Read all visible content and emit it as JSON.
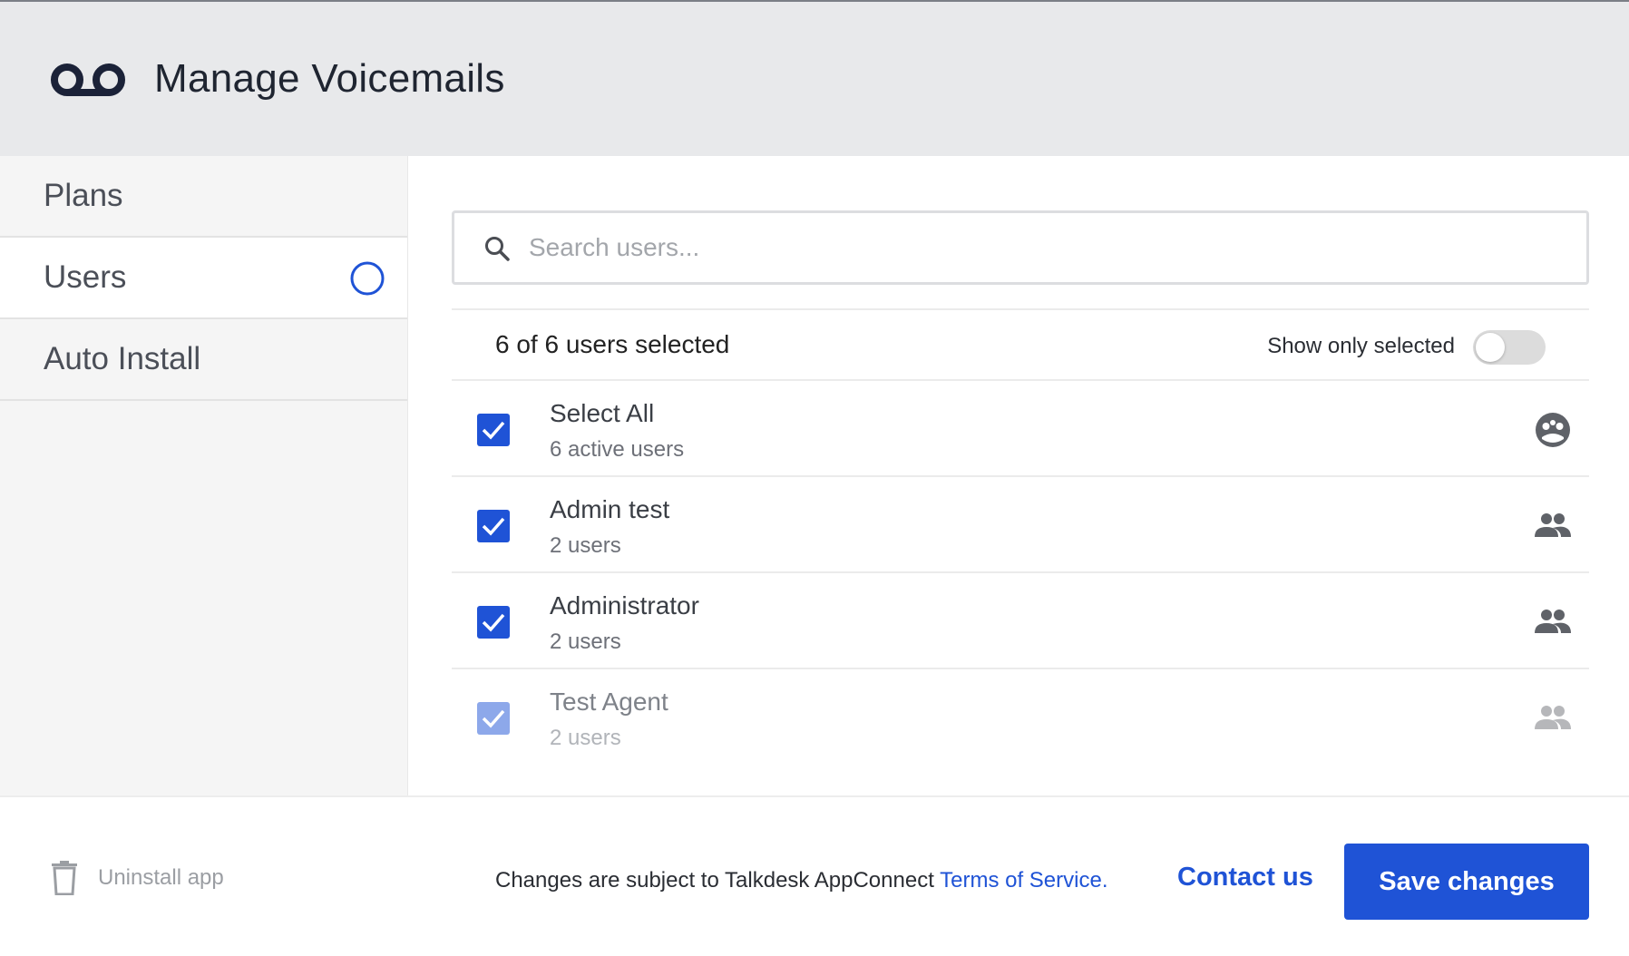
{
  "header": {
    "title": "Manage Voicemails",
    "logo_icon": "voicemail-icon"
  },
  "sidebar": {
    "items": [
      {
        "label": "Plans",
        "active": false
      },
      {
        "label": "Users",
        "active": true,
        "status_icon": "progress-ring-icon"
      },
      {
        "label": "Auto Install",
        "active": false
      }
    ]
  },
  "search": {
    "placeholder": "Search users...",
    "value": ""
  },
  "summary": {
    "count_text": "6 of 6 users selected",
    "toggle_label": "Show only selected",
    "toggle_on": false
  },
  "rows": [
    {
      "name": "Select All",
      "sub": "6 active users",
      "checked": true,
      "icon": "all-users-icon"
    },
    {
      "name": "Admin test",
      "sub": "2 users",
      "checked": true,
      "icon": "group-icon"
    },
    {
      "name": "Administrator",
      "sub": "2 users",
      "checked": true,
      "icon": "group-icon"
    },
    {
      "name": "Test Agent",
      "sub": "2 users",
      "checked": true,
      "icon": "group-icon"
    }
  ],
  "footer": {
    "uninstall_label": "Uninstall app",
    "terms_text": "Changes are subject to Talkdesk AppConnect ",
    "terms_link": "Terms of Service.",
    "contact_label": "Contact us",
    "save_label": "Save changes"
  },
  "colors": {
    "accent": "#1f53d6",
    "header_bg": "#e8e9eb",
    "sidebar_bg": "#f5f5f5"
  }
}
